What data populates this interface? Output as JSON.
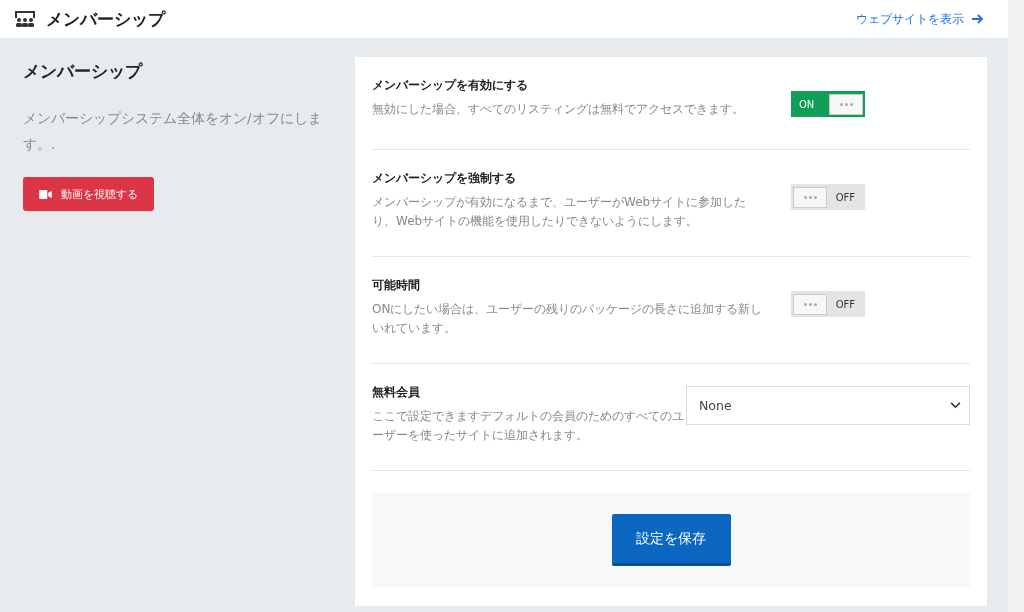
{
  "header": {
    "title": "メンバーシップ",
    "link": "ウェブサイトを表示"
  },
  "intro": {
    "title": "メンバーシップ",
    "description": "メンバーシップシステム全体をオン/オフにします。.",
    "video_button": "動画を視聴する"
  },
  "settings": [
    {
      "kind": "toggle",
      "title": "メンバーシップを有効にする",
      "description": "無効にした場合、すべてのリスティングは無料でアクセスできます。",
      "on": true,
      "state_label": "ON"
    },
    {
      "kind": "toggle",
      "title": "メンバーシップを強制する",
      "description": "メンバーシップが有効になるまで、ユーザーがWebサイトに参加したり、Webサイトの機能を使用したりできないようにします。",
      "on": false,
      "state_label": "OFF"
    },
    {
      "kind": "toggle",
      "title": "可能時間",
      "description": "ONにしたい場合は、ユーザーの残りのパッケージの長さに追加する新しいれています。",
      "on": false,
      "state_label": "OFF"
    },
    {
      "kind": "select",
      "title": "無料会員",
      "description": "ここで設定できますデフォルトの会員のためのすべてのユーザーを使ったサイトに追加されます。",
      "value": "None"
    }
  ],
  "save_button": "設定を保存"
}
